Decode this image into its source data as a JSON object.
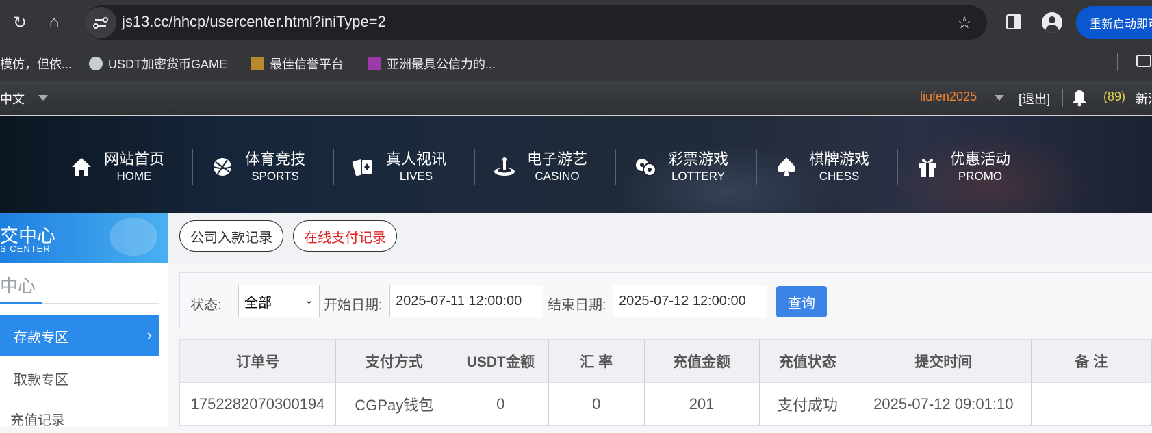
{
  "browser": {
    "url": "js13.cc/hhcp/usercenter.html?iniType=2",
    "restart_label": "重新启动即可",
    "bookmarks": [
      {
        "label": "模仿，但依...",
        "icon": "none"
      },
      {
        "label": "USDT加密货币GAME",
        "icon": "globe-icon"
      },
      {
        "label": "最佳信誉平台",
        "icon": "brand-icon"
      },
      {
        "label": "亚洲最具公信力的...",
        "icon": "brand-icon"
      }
    ]
  },
  "topbar": {
    "language": "中文",
    "username": "liufen2025",
    "logout": "[退出]",
    "message_count": "(89)",
    "message_label": "新消息"
  },
  "nav": [
    {
      "cn": "网站首页",
      "en": "HOME",
      "icon": "home-icon"
    },
    {
      "cn": "体育竞技",
      "en": "SPORTS",
      "icon": "sports-icon"
    },
    {
      "cn": "真人视讯",
      "en": "LIVES",
      "icon": "cards-icon"
    },
    {
      "cn": "电子游艺",
      "en": "CASINO",
      "icon": "casino-icon"
    },
    {
      "cn": "彩票游戏",
      "en": "LOTTERY",
      "icon": "lottery-icon"
    },
    {
      "cn": "棋牌游戏",
      "en": "CHESS",
      "icon": "spade-icon"
    },
    {
      "cn": "优惠活动",
      "en": "PROMO",
      "icon": "gift-icon"
    }
  ],
  "sidebar": {
    "title_cn": "交中心",
    "title_en": "S CENTER",
    "subtitle": "中心",
    "items": [
      {
        "label": "存款专区",
        "active": true
      },
      {
        "label": "取款专区",
        "active": false
      },
      {
        "label": "充值记录",
        "active": false
      }
    ]
  },
  "tabs": [
    {
      "label": "公司入款记录",
      "active": false
    },
    {
      "label": "在线支付记录",
      "active": true
    }
  ],
  "filter": {
    "status_label": "状态:",
    "status_value": "全部",
    "start_label": "开始日期:",
    "start_value": "2025-07-11 12:00:00",
    "end_label": "结束日期:",
    "end_value": "2025-07-12 12:00:00",
    "query_label": "查询"
  },
  "table": {
    "headers": [
      "订单号",
      "支付方式",
      "USDT金额",
      "汇 率",
      "充值金额",
      "充值状态",
      "提交时间",
      "备 注"
    ],
    "rows": [
      [
        "1752282070300194",
        "CGPay钱包",
        "0",
        "0",
        "201",
        "支付成功",
        "2025-07-12 09:01:10",
        ""
      ]
    ]
  },
  "colors": {
    "accent": "#2a8bea",
    "active_tab": "#e02020",
    "username": "#f0822d",
    "message_count": "#e6d34a"
  }
}
